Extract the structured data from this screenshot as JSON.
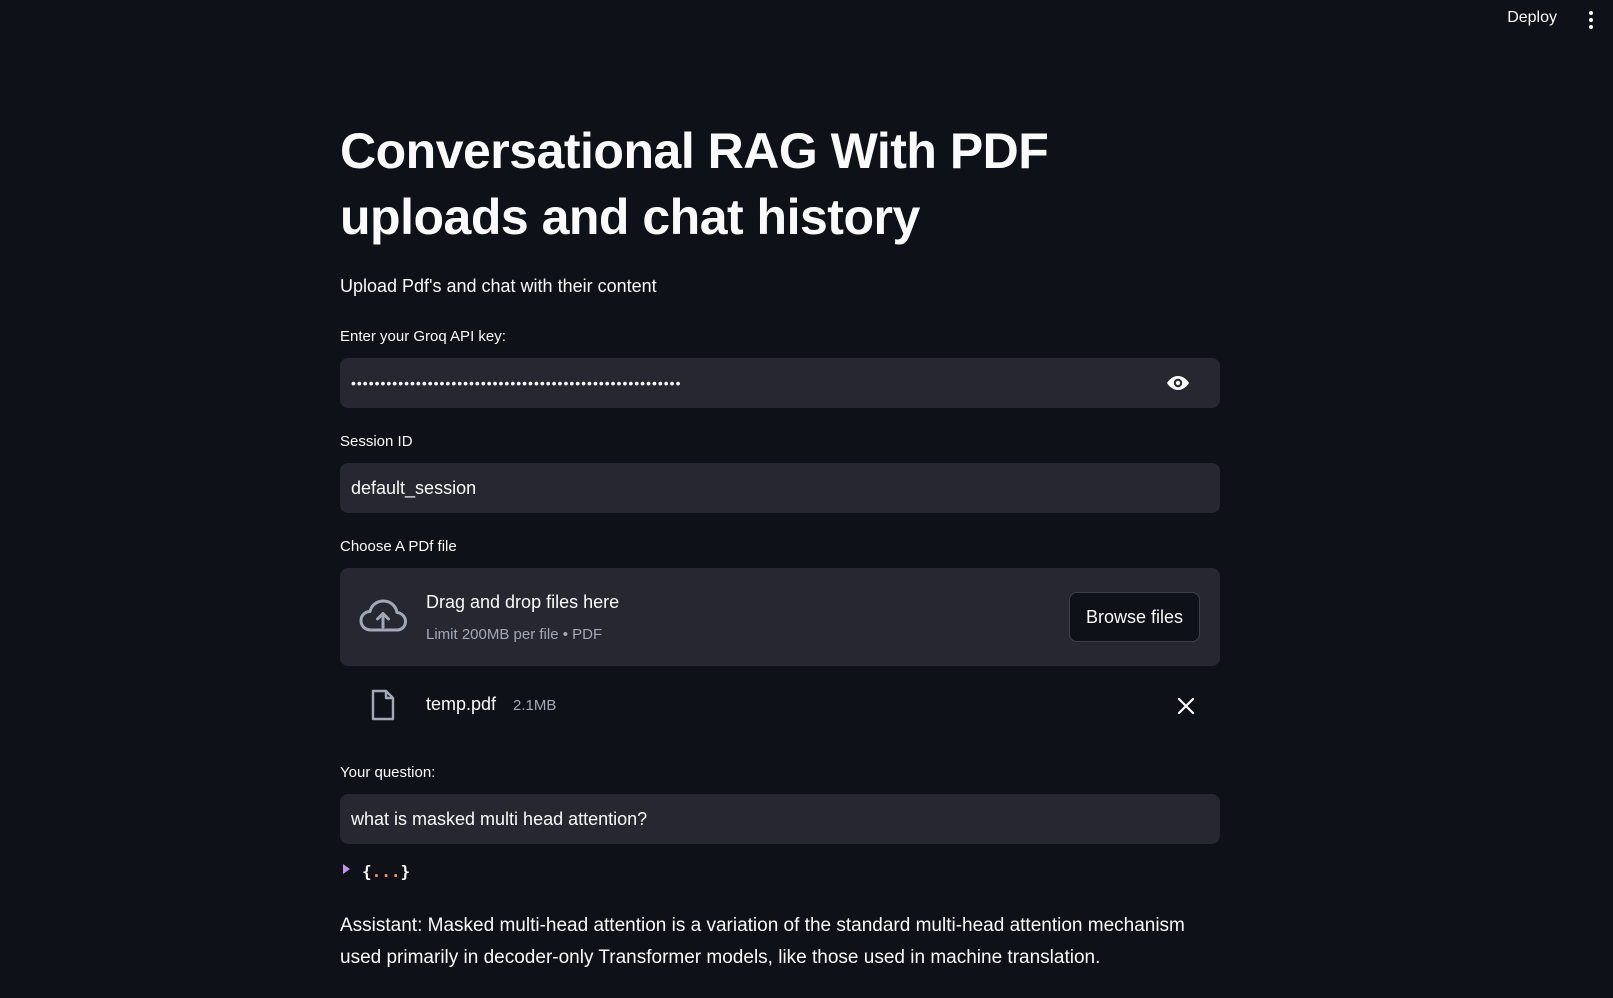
{
  "header": {
    "deploy_label": "Deploy",
    "menu_icon": "kebab-menu-icon"
  },
  "main": {
    "title": "Conversational RAG With PDF uploads and chat history",
    "subtitle": "Upload Pdf's and chat with their content",
    "api_key": {
      "label": "Enter your Groq API key:",
      "masked_value": "••••••••••••••••••••••••••••••••••••••••••••••••••••••••",
      "toggle_icon": "eye-icon"
    },
    "session": {
      "label": "Session ID",
      "value": "default_session"
    },
    "uploader": {
      "label": "Choose A PDf file",
      "drop_title": "Drag and drop files here",
      "drop_subtitle": "Limit 200MB per file • PDF",
      "browse_label": "Browse files",
      "icon": "cloud-upload-icon"
    },
    "uploaded_file": {
      "name": "temp.pdf",
      "size": "2.1MB",
      "icon": "file-icon",
      "remove_icon": "close-icon"
    },
    "question": {
      "label": "Your question:",
      "value": "what is masked multi head attention?"
    },
    "json_viewer": {
      "open_brace": "{",
      "dots": "...",
      "close_brace": "}"
    },
    "answer": "Assistant: Masked multi-head attention is a variation of the standard multi-head attention mechanism used primarily in decoder-only Transformer models, like those used in machine translation."
  },
  "colors": {
    "background": "#0e1117",
    "input_background": "#262730",
    "text": "#fafafa",
    "muted_text": "#a3a8b8",
    "json_caret": "#c792ea",
    "json_dots": "#f78c6c"
  }
}
